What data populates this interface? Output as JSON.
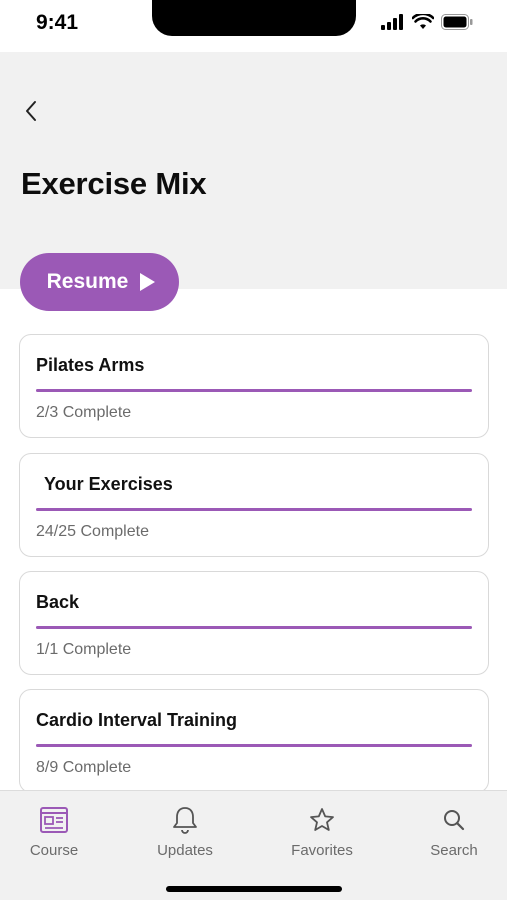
{
  "status_bar": {
    "time": "9:41"
  },
  "header": {
    "title": "Exercise Mix"
  },
  "resume_button": {
    "label": "Resume"
  },
  "colors": {
    "accent": "#9b59b6",
    "header_bg": "#f1f1f1",
    "muted_text": "#6b6b6b"
  },
  "cards": [
    {
      "title": "Pilates Arms",
      "status": "2/3 Complete",
      "progress": 1.0
    },
    {
      "title": "Your Exercises",
      "status": "24/25 Complete",
      "progress": 1.0
    },
    {
      "title": "Back",
      "status": "1/1 Complete",
      "progress": 1.0
    },
    {
      "title": "Cardio Interval Training",
      "status": "8/9 Complete",
      "progress": 1.0
    }
  ],
  "tabs": [
    {
      "label": "Course",
      "icon": "course-icon",
      "active": true
    },
    {
      "label": "Updates",
      "icon": "bell-icon",
      "active": false
    },
    {
      "label": "Favorites",
      "icon": "star-icon",
      "active": false
    },
    {
      "label": "Search",
      "icon": "search-icon",
      "active": false
    }
  ]
}
